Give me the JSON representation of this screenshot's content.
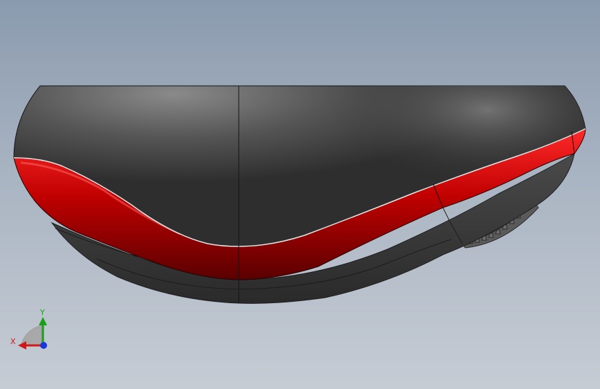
{
  "viewport": {
    "background_top": "#8a9aae",
    "background_bottom": "#c6ccd4"
  },
  "model": {
    "body_color": "#3c3c3c",
    "accent_color": "#c00000",
    "wheel_color": "#4a4a4a"
  },
  "triad": {
    "x_label": "X",
    "y_label": "Y",
    "x_color": "#d01818",
    "y_color": "#18a018",
    "z_color": "#1a38d8"
  }
}
